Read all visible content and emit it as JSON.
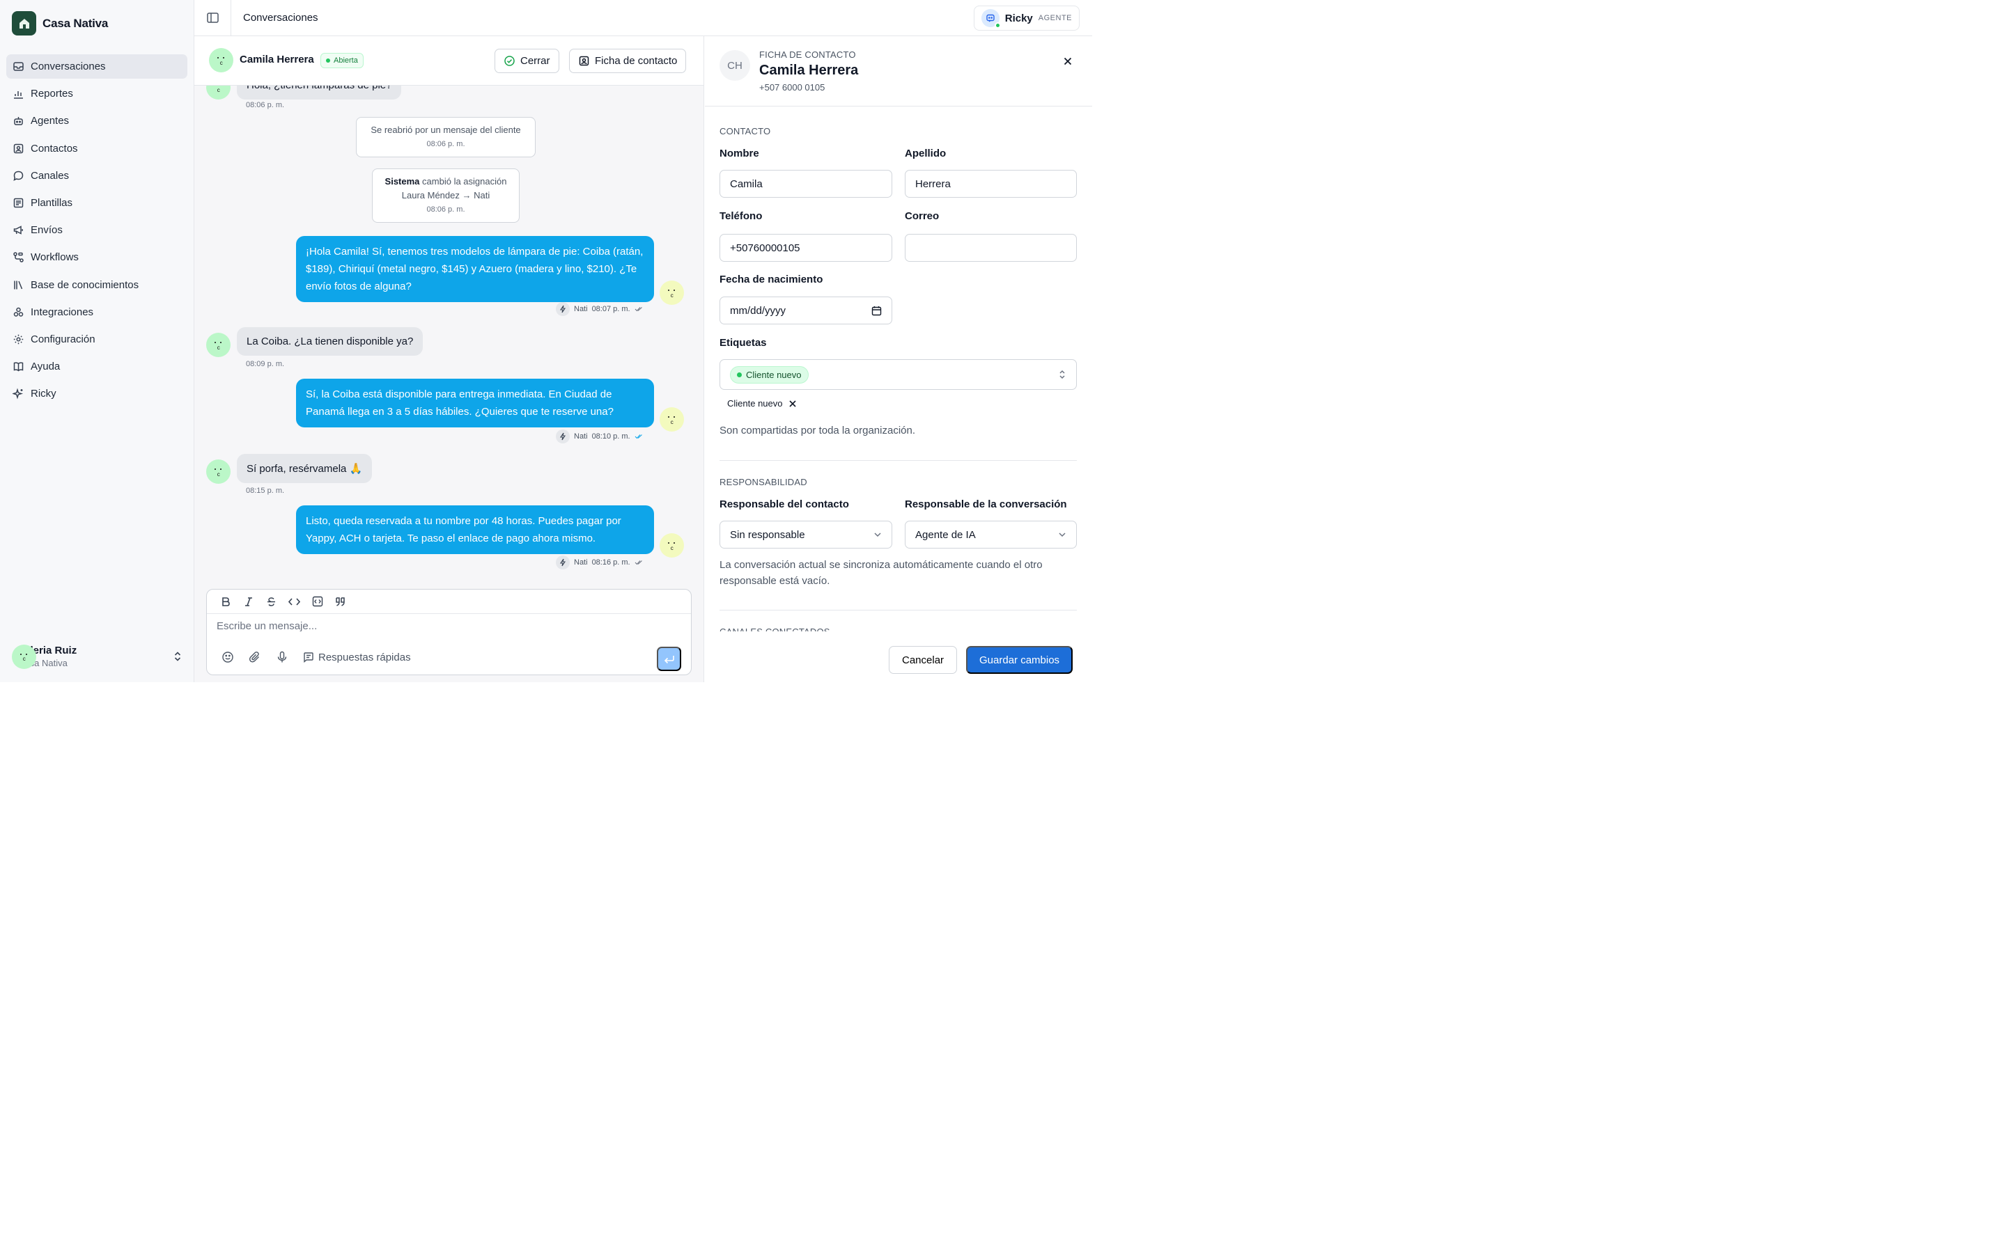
{
  "brand": {
    "name": "Casa Nativa",
    "accent": "#1f4d3a"
  },
  "nav": {
    "items": [
      {
        "label": "Conversaciones",
        "icon": "inbox-icon",
        "active": true
      },
      {
        "label": "Reportes",
        "icon": "chart-icon"
      },
      {
        "label": "Agentes",
        "icon": "bot-icon"
      },
      {
        "label": "Contactos",
        "icon": "contacts-icon"
      },
      {
        "label": "Canales",
        "icon": "chat-bubble-icon"
      },
      {
        "label": "Plantillas",
        "icon": "template-icon"
      },
      {
        "label": "Envíos",
        "icon": "megaphone-icon"
      },
      {
        "label": "Workflows",
        "icon": "workflow-icon"
      },
      {
        "label": "Base de conocimientos",
        "icon": "library-icon"
      },
      {
        "label": "Integraciones",
        "icon": "integrations-icon"
      },
      {
        "label": "Configuración",
        "icon": "gear-icon"
      },
      {
        "label": "Ayuda",
        "icon": "book-icon"
      },
      {
        "label": "Ricky",
        "icon": "sparkle-icon"
      }
    ]
  },
  "user": {
    "name": "Valeria Ruiz",
    "org": "Casa Nativa"
  },
  "topbar": {
    "title": "Conversaciones",
    "agent_name": "Ricky",
    "agent_role": "AGENTE"
  },
  "conversation": {
    "contact_name": "Camila Herrera",
    "status": "Abierta",
    "close_label": "Cerrar",
    "contact_card_label": "Ficha de contacto",
    "messages": {
      "m0_text": "Hola, ¿tienen lámparas de pie?",
      "m0_time": "08:06 p. m.",
      "sys1_text": "Se reabrió por un mensaje del cliente",
      "sys1_time": "08:06 p. m.",
      "sys2_actor": "Sistema",
      "sys2_action": "cambió la asignación",
      "sys2_change": "Laura Méndez → Nati",
      "sys2_time": "08:06 p. m.",
      "m1_text": "¡Hola Camila! Sí, tenemos tres modelos de lámpara de pie: Coiba (ratán, $189), Chiriquí (metal negro, $145) y Azuero (madera y lino, $210). ¿Te envío fotos de alguna?",
      "m1_author": "Nati",
      "m1_time": "08:07 p. m.",
      "m2_text": "La Coiba. ¿La tienen disponible ya?",
      "m2_time": "08:09 p. m.",
      "m3_text": "Sí, la Coiba está disponible para entrega inmediata. En Ciudad de Panamá llega en 3 a 5 días hábiles. ¿Quieres que te reserve una?",
      "m3_author": "Nati",
      "m3_time": "08:10 p. m.",
      "m4_text": "Sí porfa, resérvamela 🙏",
      "m4_time": "08:15 p. m.",
      "m5_text": "Listo, queda reservada a tu nombre por 48 horas. Puedes pagar por Yappy, ACH o tarjeta. Te paso el enlace de pago ahora mismo.",
      "m5_author": "Nati",
      "m5_time": "08:16 p. m."
    }
  },
  "composer": {
    "placeholder": "Escribe un mensaje...",
    "quick_replies_label": "Respuestas rápidas"
  },
  "contact_panel": {
    "kicker": "FICHA DE CONTACTO",
    "initials": "CH",
    "name": "Camila Herrera",
    "phone": "+507 6000 0105",
    "section_contact": "CONTACTO",
    "first_name_label": "Nombre",
    "first_name_value": "Camila",
    "last_name_label": "Apellido",
    "last_name_value": "Herrera",
    "phone_label": "Teléfono",
    "phone_value": "+50760000105",
    "email_label": "Correo",
    "email_value": "",
    "birth_label": "Fecha de nacimiento",
    "birth_placeholder": "mm/dd/yyyy",
    "tags_label": "Etiquetas",
    "tag_selected": "Cliente nuevo",
    "tag_chip": "Cliente nuevo",
    "tags_help": "Son compartidas por toda la organización.",
    "section_responsibility": "RESPONSABILIDAD",
    "contact_owner_label": "Responsable del contacto",
    "contact_owner_value": "Sin responsable",
    "conv_owner_label": "Responsable de la conversación",
    "conv_owner_value": "Agente de IA",
    "sync_help": "La conversación actual se sincroniza automáticamente cuando el otro responsable está vacío.",
    "section_channels": "CANALES CONECTADOS",
    "cancel_label": "Cancelar",
    "save_label": "Guardar cambios"
  },
  "colors": {
    "outgoing_bubble": "#0ea5e9",
    "primary_button": "#1d6ed8",
    "status_green": "#22c55e"
  }
}
